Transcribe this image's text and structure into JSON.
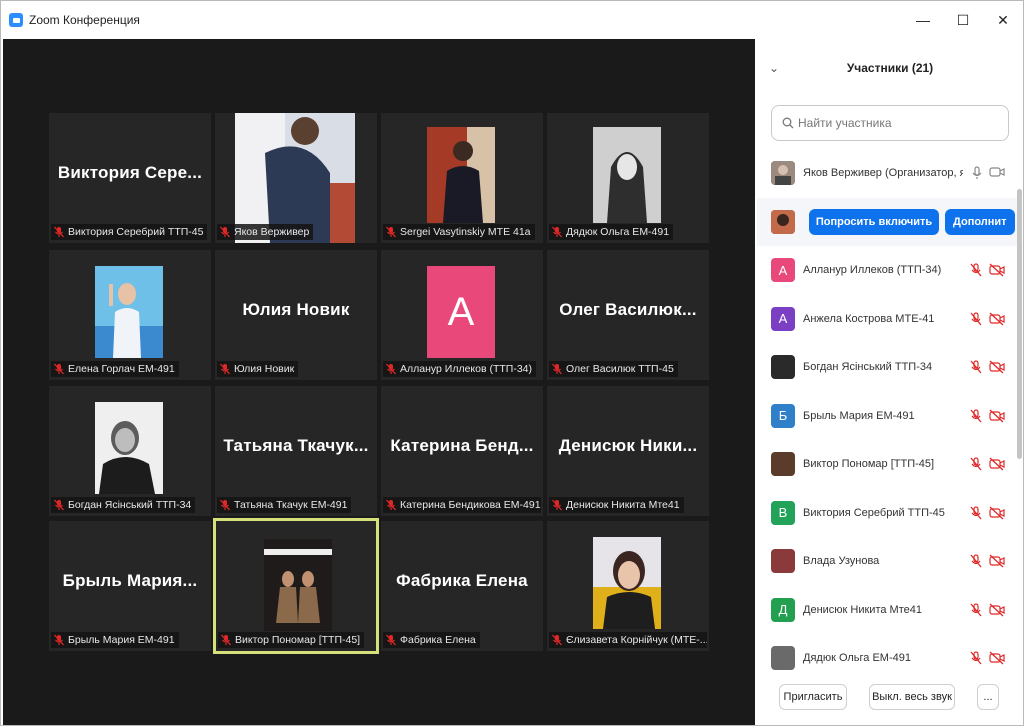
{
  "window": {
    "title": "Zoom Конференция",
    "minimize": "—",
    "maximize": "☐",
    "close": "✕"
  },
  "tiles": [
    {
      "big": "Виктория  Сере...",
      "label": "Виктория Серебрий ТТП-45"
    },
    {
      "big": "",
      "label": "Яков Верживер"
    },
    {
      "big": "",
      "label": "Sergei Vasytinskiy МТЕ 41а"
    },
    {
      "big": "",
      "label": "Дядюк Ольга ЕМ-491"
    },
    {
      "big": "",
      "label": "Елена Горлач ЕМ-491"
    },
    {
      "big": "Юлия Новик",
      "label": "Юлия Новик"
    },
    {
      "big": "",
      "letter": "А",
      "label": "Алланур Иллеков (ТТП-34)"
    },
    {
      "big": "Олег  Василюк...",
      "label": "Олег Василюк ТТП-45"
    },
    {
      "big": "",
      "label": "Богдан Ясінський ТТП-34"
    },
    {
      "big": "Татьяна  Ткачук...",
      "label": "Татьяна Ткачук ЕМ-491"
    },
    {
      "big": "Катерина  Бенд...",
      "label": "Катерина Бендикова ЕМ-491"
    },
    {
      "big": "Денисюк  Ники...",
      "label": "Денисюк Никита Мте41"
    },
    {
      "big": "Брыль  Мария...",
      "label": "Брыль Мария ЕМ-491"
    },
    {
      "big": "",
      "label": "Виктор Пономар [ТТП-45]"
    },
    {
      "big": "Фабрика Елена",
      "label": "Фабрика Елена"
    },
    {
      "big": "",
      "label": "Єлизавета Корнійчук (МТЕ-..."
    }
  ],
  "panel": {
    "title": "Участники (21)",
    "search_placeholder": "Найти участника",
    "host": "Яков Верживер (Организатор, я)",
    "ask_unmute": "Попросить включить",
    "more": "Дополнит",
    "participants": [
      {
        "name": "Алланур Иллеков (ТТП-34)",
        "letter": "А",
        "color": "#e8497a"
      },
      {
        "name": "Анжела Кострова МТЕ-41",
        "letter": "А",
        "color": "#7b3fc4"
      },
      {
        "name": "Богдан Ясінський ТТП-34",
        "letter": "",
        "color": "#2a2a2a"
      },
      {
        "name": "Брыль Мария ЕМ-491",
        "letter": "Б",
        "color": "#2f80c8"
      },
      {
        "name": "Виктор Пономар [ТТП-45]",
        "letter": "",
        "color": "#5b3b2a"
      },
      {
        "name": "Виктория Серебрий ТТП-45",
        "letter": "В",
        "color": "#23a35a"
      },
      {
        "name": "Влада Узунова",
        "letter": "",
        "color": "#8a3a3a"
      },
      {
        "name": "Денисюк Никита Мте41",
        "letter": "Д",
        "color": "#22a04f"
      },
      {
        "name": "Дядюк Ольга ЕМ-491",
        "letter": "",
        "color": "#6a6a6a"
      }
    ],
    "invite": "Пригласить",
    "mute_all": "Выкл. весь звук",
    "ellipsis": "..."
  }
}
